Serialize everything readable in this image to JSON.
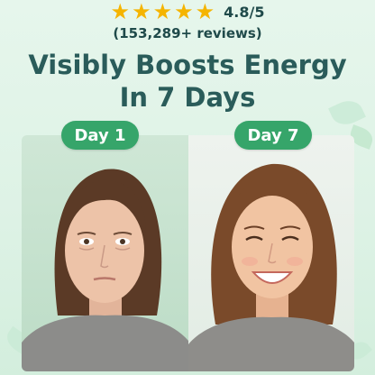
{
  "rating": {
    "stars": 5,
    "star_icon": "star-icon",
    "value": "4.8/5",
    "reviews": "(153,289+ reviews)"
  },
  "headline": {
    "line1": "Visibly Boosts Energy",
    "line2": "In 7 Days"
  },
  "comparison": {
    "before": {
      "label": "Day 1"
    },
    "after": {
      "label": "Day 7"
    }
  },
  "colors": {
    "accent": "#36a56a",
    "headline": "#2a5c5a",
    "star": "#f5b400"
  }
}
